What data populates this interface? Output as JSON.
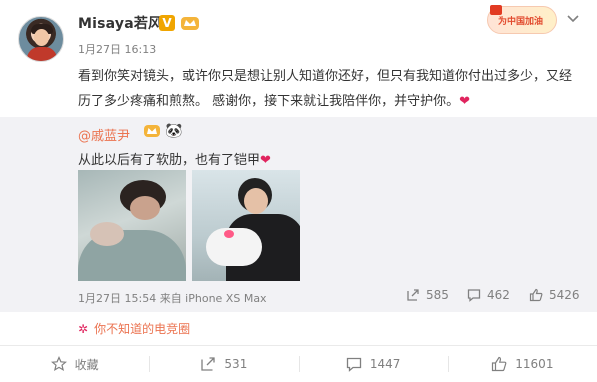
{
  "post": {
    "author": "Misaya若风",
    "vip_badge": "V",
    "timestamp": "1月27日 16:13",
    "text": "看到你笑对镜头，或许你只是想让别人知道你还好，但只有我知道你付出过多少，又经历了多少疼痛和煎熬。 感谢你，接下来就让我陪伴你，并守护你。",
    "heart_glyph": "❤",
    "banner_badge_text": "为中国加油",
    "accent_color": "#eb7350",
    "heart_color": "#e0245e"
  },
  "repost": {
    "author": "@戚蓝尹",
    "panda_glyph": "🐼",
    "text": "从此以后有了软肋，也有了铠甲",
    "heart_glyph": "❤",
    "meta": "1月27日 15:54 来自 iPhone XS Max",
    "stats": {
      "share_count": "585",
      "comment_count": "462",
      "like_count": "5426"
    }
  },
  "source": {
    "label": "你不知道的电竞圈"
  },
  "actions": {
    "favorite_label": "收藏",
    "share_count": "531",
    "comment_count": "1447",
    "like_count": "11601"
  },
  "icons": [
    "avatar",
    "vip-v-icon",
    "crown-icon",
    "chevron-down-icon",
    "panda-icon",
    "share-icon",
    "comment-icon",
    "like-icon",
    "star-icon",
    "flower-icon"
  ]
}
